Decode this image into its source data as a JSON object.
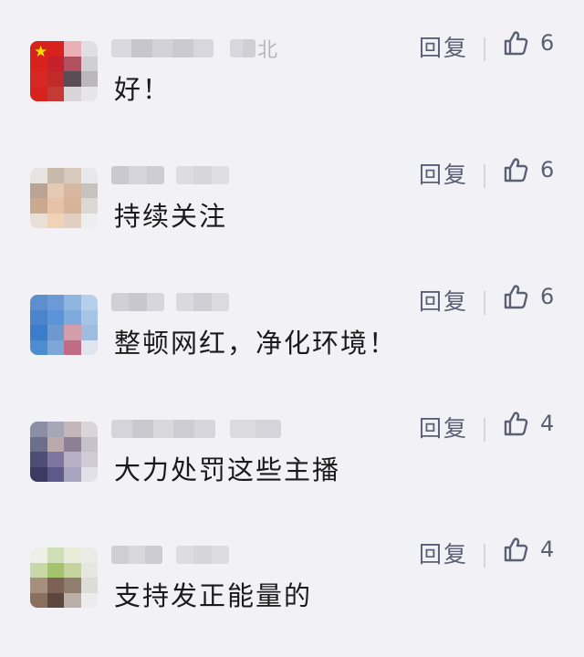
{
  "colors": {
    "background": "#f2f2f6",
    "action_text": "#5a5f73",
    "comment_text": "#1a1a1a"
  },
  "comments": [
    {
      "name_suffix": "北",
      "text": "好！",
      "reply_label": "回复",
      "like_count": "6",
      "avatar_colors": [
        "#d8221d",
        "#d8221d",
        "#e9b0b5",
        "#e0e0e4",
        "#d8221d",
        "#c7202a",
        "#b05060",
        "#cfcfd4",
        "#d82823",
        "#c22a2a",
        "#5a4c52",
        "#bbb7bb",
        "#d8221d",
        "#c63a36",
        "#d9d4d8",
        "#e6e6ea"
      ]
    },
    {
      "text": "持续关注",
      "reply_label": "回复",
      "like_count": "6",
      "avatar_colors": [
        "#e7e4e2",
        "#c9b9ad",
        "#d8c9bd",
        "#e8e8ea",
        "#bba394",
        "#e4c9b3",
        "#d7b79e",
        "#c7c2be",
        "#caa98f",
        "#e6c3a7",
        "#d6b498",
        "#dcd8d4",
        "#e9dfd6",
        "#f2d2b6",
        "#e1d0c2",
        "#eeeeef"
      ]
    },
    {
      "text": "整顿网红，净化环境！",
      "reply_label": "回复",
      "like_count": "6",
      "avatar_colors": [
        "#5d8fce",
        "#6b9ad6",
        "#8fb5e1",
        "#b7cfea",
        "#4a84cc",
        "#5b95d8",
        "#80a9dc",
        "#a7c4e6",
        "#3b7dcb",
        "#6f98cf",
        "#d39ea9",
        "#9fbce0",
        "#4e8cd2",
        "#7da6d9",
        "#c06c86",
        "#dfe4ee"
      ]
    },
    {
      "text": "大力处罚这些主播",
      "reply_label": "回复",
      "like_count": "4",
      "avatar_colors": [
        "#8b8fa6",
        "#a5a7b6",
        "#c3b7b9",
        "#d9d6da",
        "#6b6f8c",
        "#b9a9aa",
        "#8d7f96",
        "#c7c2ca",
        "#4e4d74",
        "#7d76a0",
        "#b7b0c6",
        "#d0ccd6",
        "#3c3a63",
        "#5e5988",
        "#a9a4be",
        "#e3e1e8"
      ]
    },
    {
      "text": "支持发正能量的",
      "reply_label": "回复",
      "like_count": "4",
      "avatar_colors": [
        "#efefe9",
        "#cfe0b8",
        "#e8ecd9",
        "#eaeae6",
        "#c9d8a9",
        "#a3c46d",
        "#c6d39f",
        "#e7e7e2",
        "#a68f7d",
        "#7d6253",
        "#8f7d6f",
        "#ddddd8",
        "#8a6e5e",
        "#5d463c",
        "#b9afa6",
        "#ececec"
      ]
    }
  ]
}
